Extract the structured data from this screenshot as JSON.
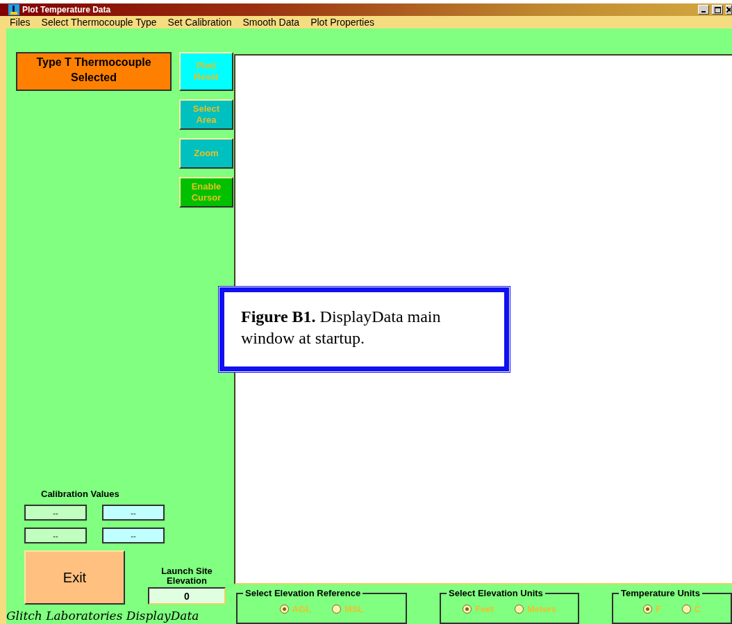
{
  "window": {
    "title": "Plot Temperature Data"
  },
  "menu": [
    {
      "label": "Files"
    },
    {
      "label": "Select Thermocouple Type"
    },
    {
      "label": "Set Calibration"
    },
    {
      "label": "Smooth Data"
    },
    {
      "label": "Plot Properties"
    }
  ],
  "thermocouple_status": "Type T Thermocouple Selected",
  "tool_buttons": [
    {
      "label": "Plot/ Reset",
      "color": "#00ffff"
    },
    {
      "label": "Select Area",
      "color": "#00c0c0"
    },
    {
      "label": "Zoom",
      "color": "#00c0c0"
    },
    {
      "label": "Enable Cursor",
      "color": "#00c000"
    }
  ],
  "calibration": {
    "title": "Calibration Values",
    "fields": [
      {
        "value": "--",
        "color": "#c0ffc0"
      },
      {
        "value": "--",
        "color": "#c0ffff"
      },
      {
        "value": "--",
        "color": "#c0ffc0"
      },
      {
        "value": "--",
        "color": "#c0ffff"
      }
    ]
  },
  "exit_button": "Exit",
  "launch_site": {
    "label": "Launch Site Elevation",
    "value": "0"
  },
  "footer": "Glitch Laboratories DisplayData",
  "radio_groups": [
    {
      "title": "Select Elevation Reference",
      "options": [
        {
          "label": "AGL",
          "selected": true
        },
        {
          "label": "MSL",
          "selected": false
        }
      ]
    },
    {
      "title": "Select Elevation Units",
      "options": [
        {
          "label": "Feet",
          "selected": true
        },
        {
          "label": "Meters",
          "selected": false
        }
      ]
    },
    {
      "title": "Temperature Units",
      "options": [
        {
          "label": "F",
          "selected": true
        },
        {
          "label": "C",
          "selected": false
        }
      ]
    }
  ],
  "caption": "**Figure B1.**  DisplayData main window at startup."
}
